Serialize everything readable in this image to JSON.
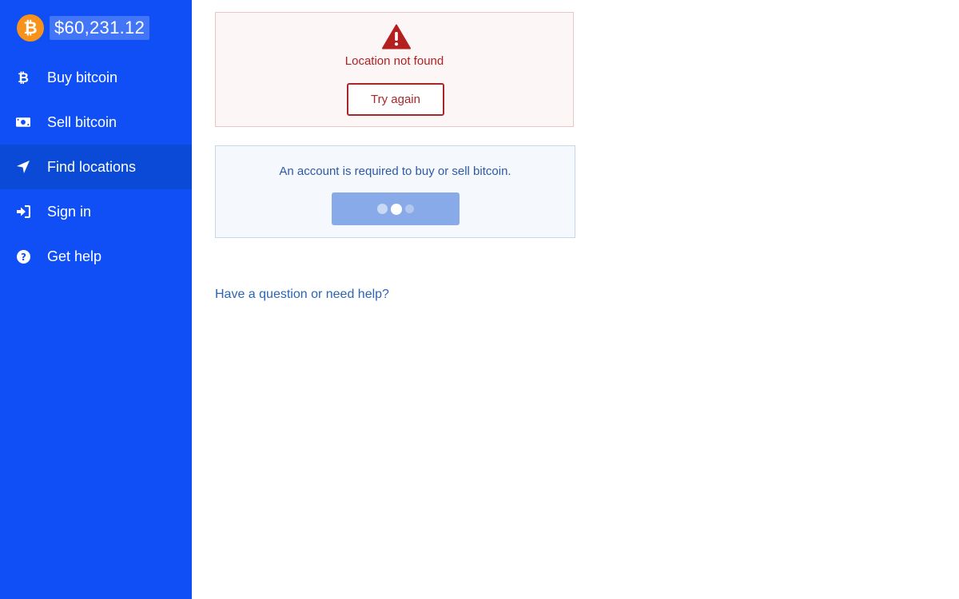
{
  "sidebar": {
    "price": "$60,231.12",
    "items": [
      {
        "label": "Buy bitcoin",
        "icon": "bitcoin-icon",
        "active": false
      },
      {
        "label": "Sell bitcoin",
        "icon": "money-icon",
        "active": false
      },
      {
        "label": "Find locations",
        "icon": "location-arrow-icon",
        "active": true
      },
      {
        "label": "Sign in",
        "icon": "sign-in-icon",
        "active": false
      },
      {
        "label": "Get help",
        "icon": "question-circle-icon",
        "active": false
      }
    ]
  },
  "error_card": {
    "message": "Location not found",
    "button_label": "Try again"
  },
  "account_card": {
    "message": "An account is required to buy or sell bitcoin."
  },
  "help_link": "Have a question or need help?",
  "colors": {
    "sidebar": "#0f4ff5",
    "active_item": "#0b4ad6",
    "bitcoin": "#f7931a",
    "error": "#b3201f",
    "link": "#2d64b4"
  }
}
